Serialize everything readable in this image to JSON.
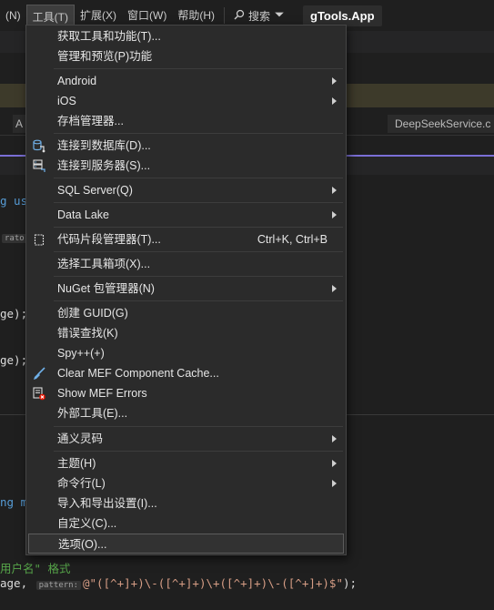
{
  "menubar": {
    "items": [
      {
        "label": "(N)"
      },
      {
        "label": "工具(T)"
      },
      {
        "label": "扩展(X)"
      },
      {
        "label": "窗口(W)"
      },
      {
        "label": "帮助(H)"
      }
    ],
    "search_label": "搜索",
    "app_title": "gTools.App"
  },
  "background": {
    "tab_left": "A",
    "tab_right": "DeepSeekService.c",
    "code_lines": {
      "l1": "g us",
      "l1_hint": "rator",
      "l2": "ge);",
      "l3": "ge);",
      "l4": "ng m",
      "comment": "用户名\" 格式",
      "last_prefix": "age, ",
      "last_hint": "pattern:",
      "last_at": "@",
      "last_str": "\"([^+]+)\\-([^+]+)\\+([^+]+)\\-([^+]+)$\"",
      "last_end": ");"
    }
  },
  "menu": {
    "items": [
      {
        "label": "获取工具和功能(T)...",
        "icon": "none"
      },
      {
        "label": "管理和预览(P)功能",
        "icon": "none"
      },
      {
        "label": "Android",
        "icon": "none",
        "submenu": true
      },
      {
        "label": "iOS",
        "icon": "none",
        "submenu": true
      },
      {
        "label": "存档管理器...",
        "icon": "none"
      },
      {
        "label": "连接到数据库(D)...",
        "icon": "database-connect-icon"
      },
      {
        "label": "连接到服务器(S)...",
        "icon": "server-connect-icon"
      },
      {
        "label": "SQL Server(Q)",
        "icon": "none",
        "submenu": true
      },
      {
        "label": "Data Lake",
        "icon": "none",
        "submenu": true
      },
      {
        "label": "代码片段管理器(T)...",
        "shortcut": "Ctrl+K, Ctrl+B",
        "icon": "snippet-icon"
      },
      {
        "label": "选择工具箱项(X)...",
        "icon": "none"
      },
      {
        "label": "NuGet 包管理器(N)",
        "icon": "none",
        "submenu": true
      },
      {
        "label": "创建 GUID(G)",
        "icon": "none"
      },
      {
        "label": "错误查找(K)",
        "icon": "none"
      },
      {
        "label": "Spy++(+)",
        "icon": "none"
      },
      {
        "label": "Clear MEF Component Cache...",
        "icon": "broom-icon"
      },
      {
        "label": "Show MEF Errors",
        "icon": "error-list-icon"
      },
      {
        "label": "外部工具(E)...",
        "icon": "none"
      },
      {
        "label": "通义灵码",
        "icon": "none",
        "submenu": true
      },
      {
        "label": "主题(H)",
        "icon": "none",
        "submenu": true
      },
      {
        "label": "命令行(L)",
        "icon": "none",
        "submenu": true
      },
      {
        "label": "导入和导出设置(I)...",
        "icon": "none"
      },
      {
        "label": "自定义(C)...",
        "icon": "none"
      },
      {
        "label": "选项(O)...",
        "icon": "none",
        "highlighted": true
      }
    ]
  },
  "colors": {
    "menu_bg": "#2b2b2b",
    "accent": "#7b6fd6",
    "keyword": "#569cd6",
    "comment": "#57a64a",
    "string": "#d69d85"
  }
}
